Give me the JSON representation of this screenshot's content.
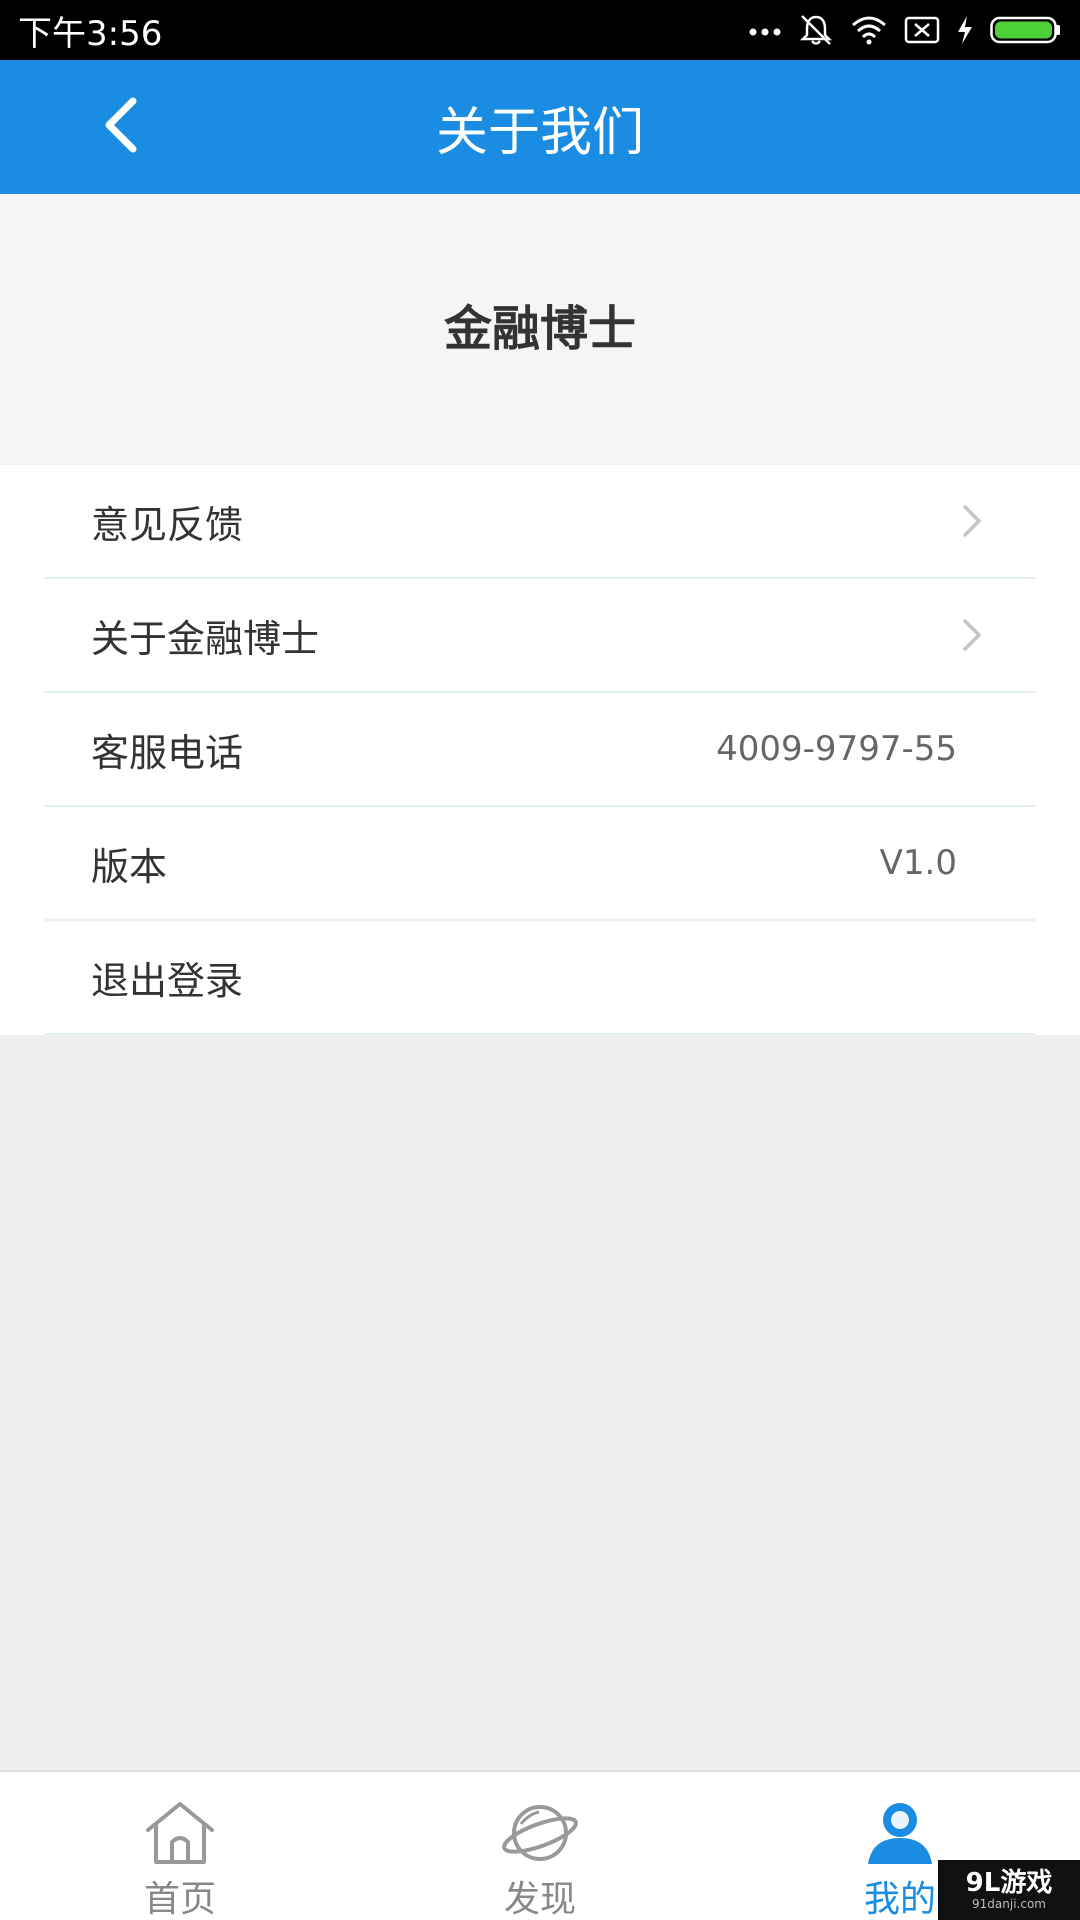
{
  "status_bar": {
    "time": "下午3:56",
    "icons": [
      "more-dots-icon",
      "mute-icon",
      "wifi-icon",
      "no-sim-icon",
      "charging-icon",
      "battery-icon"
    ]
  },
  "header": {
    "title": "关于我们",
    "back_icon": "chevron-left-icon"
  },
  "brand": {
    "app_name": "金融博士"
  },
  "menu": {
    "items": [
      {
        "label": "意见反馈",
        "value": "",
        "chevron": true
      },
      {
        "label": "关于金融博士",
        "value": "",
        "chevron": true
      },
      {
        "label": "客服电话",
        "value": "4009-9797-55",
        "chevron": false
      },
      {
        "label": "版本",
        "value": "V1.0",
        "chevron": false
      },
      {
        "label": "退出登录",
        "value": "",
        "chevron": false
      }
    ]
  },
  "bottom_nav": {
    "items": [
      {
        "label": "首页",
        "icon": "home-icon",
        "active": false
      },
      {
        "label": "发现",
        "icon": "planet-icon",
        "active": false
      },
      {
        "label": "我的",
        "icon": "user-icon",
        "active": true
      }
    ]
  },
  "colors": {
    "primary": "#1a8de3",
    "background": "#efefef",
    "divider": "#e3eef5",
    "battery": "#4cd137"
  },
  "watermark": {
    "main": "9L游戏",
    "sub": "91danji.com"
  }
}
